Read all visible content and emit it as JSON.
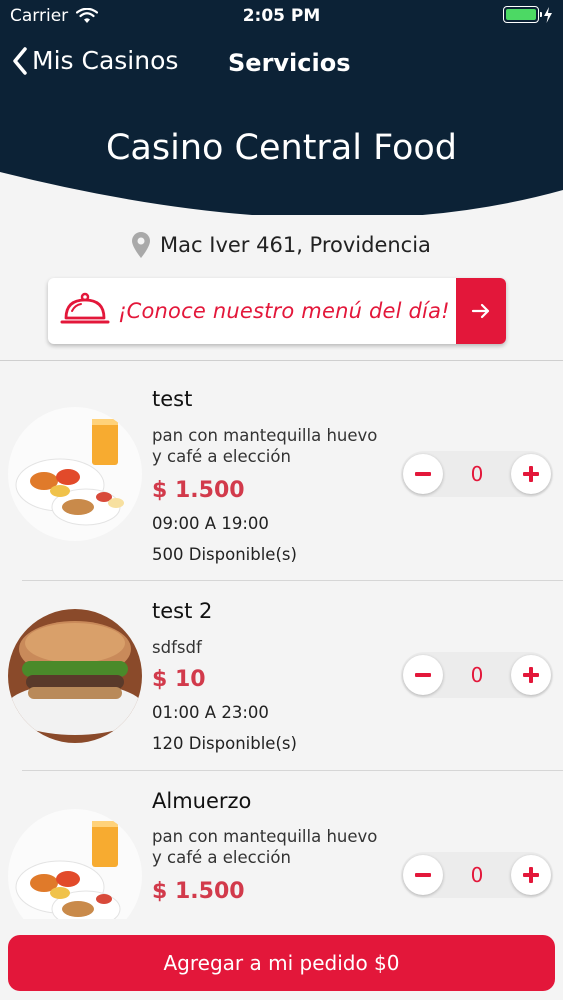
{
  "status_bar": {
    "carrier": "Carrier",
    "time": "2:05 PM"
  },
  "nav": {
    "back_label": "Mis Casinos",
    "title": "Servicios"
  },
  "casino": {
    "name": "Casino Central Food",
    "address": "Mac Iver 461, Providencia"
  },
  "menu_banner": {
    "text": "¡Conoce nuestro menú del día!"
  },
  "products": [
    {
      "name": "test",
      "description": "pan con mantequilla huevo y café a elección",
      "price": "$ 1.500",
      "hours": "09:00 A 19:00",
      "available": "500 Disponible(s)",
      "quantity": "0",
      "image": "breakfast-plate"
    },
    {
      "name": "test 2",
      "description": "sdfsdf",
      "price": "$ 10",
      "hours": "01:00 A 23:00",
      "available": "120 Disponible(s)",
      "quantity": "0",
      "image": "burger"
    },
    {
      "name": "Almuerzo",
      "description": "pan con mantequilla huevo y café a elección",
      "price": "$ 1.500",
      "hours": "",
      "available": "",
      "quantity": "0",
      "image": "breakfast-plate"
    }
  ],
  "cart_button": {
    "label": "Agregar a mi pedido $0"
  },
  "colors": {
    "header": "#0c2236",
    "accent": "#e3173a",
    "price": "#d23a4b"
  }
}
